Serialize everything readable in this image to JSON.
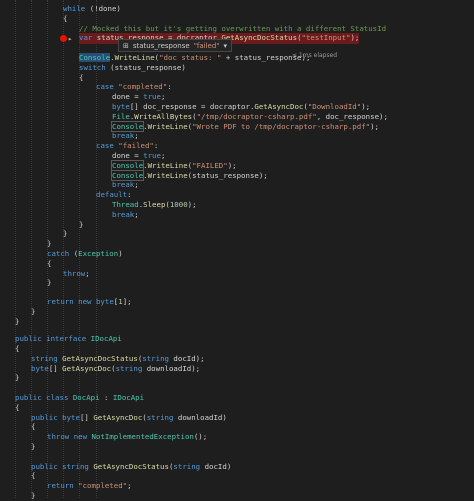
{
  "editor": {
    "lines": [
      {
        "i": 0,
        "segs": [
          [
            "kw",
            "while"
          ],
          [
            "t",
            " (!done)"
          ]
        ]
      },
      {
        "i": 1,
        "segs": [
          [
            "t",
            "{"
          ]
        ]
      },
      {
        "i": 2,
        "segs": [
          [
            "cm",
            "// Mocked this but it's getting overwritten with a different StatusId"
          ]
        ]
      },
      {
        "i": 3,
        "segs": [
          [
            "kw",
            "var"
          ],
          [
            "t",
            " status_response = docraptor."
          ],
          [
            "fn",
            "GetAsyncDocStatus"
          ],
          [
            "t",
            "("
          ],
          [
            "st",
            "\"testInput\""
          ],
          [
            "t",
            ");"
          ]
        ]
      },
      {
        "i": 4,
        "segs": []
      },
      {
        "i": 5,
        "segs": [
          [
            "ty",
            "Console"
          ],
          [
            "t",
            "."
          ],
          [
            "fn",
            "WriteLine"
          ],
          [
            "t",
            "("
          ],
          [
            "st",
            "\"doc status: \""
          ],
          [
            "t",
            " + status_response);"
          ]
        ]
      },
      {
        "i": 6,
        "segs": [
          [
            "kw",
            "switch"
          ],
          [
            "t",
            " (status_response)"
          ]
        ]
      },
      {
        "i": 7,
        "segs": [
          [
            "t",
            "{"
          ]
        ]
      },
      {
        "i": 8,
        "segs": [
          [
            "kw",
            "case"
          ],
          [
            "t",
            " "
          ],
          [
            "st",
            "\"completed\""
          ],
          [
            "t",
            ":"
          ]
        ]
      },
      {
        "i": 9,
        "segs": [
          [
            "t",
            "done = "
          ],
          [
            "kw",
            "true"
          ],
          [
            "t",
            ";"
          ]
        ]
      },
      {
        "i": 10,
        "segs": [
          [
            "kw",
            "byte"
          ],
          [
            "t",
            "[] doc_response = docraptor."
          ],
          [
            "fn",
            "GetAsyncDoc"
          ],
          [
            "t",
            "("
          ],
          [
            "st",
            "\"DownloadId\""
          ],
          [
            "t",
            ");"
          ]
        ]
      },
      {
        "i": 11,
        "segs": [
          [
            "ty",
            "File"
          ],
          [
            "t",
            "."
          ],
          [
            "fn",
            "WriteAllBytes"
          ],
          [
            "t",
            "("
          ],
          [
            "st",
            "\"/tmp/docraptor-csharp.pdf\""
          ],
          [
            "t",
            ", doc_response);"
          ]
        ]
      },
      {
        "i": 12,
        "segs": [
          [
            "ty",
            "Console"
          ],
          [
            "t",
            "."
          ],
          [
            "fn",
            "WriteLine"
          ],
          [
            "t",
            "("
          ],
          [
            "st",
            "\"Wrote PDF to /tmp/docraptor-csharp.pdf\""
          ],
          [
            "t",
            ");"
          ]
        ]
      },
      {
        "i": 13,
        "segs": [
          [
            "kw",
            "break"
          ],
          [
            "t",
            ";"
          ]
        ]
      },
      {
        "i": 14,
        "segs": [
          [
            "kw",
            "case"
          ],
          [
            "t",
            " "
          ],
          [
            "st",
            "\"failed\""
          ],
          [
            "t",
            ":"
          ]
        ]
      },
      {
        "i": 15,
        "segs": [
          [
            "t",
            "done = "
          ],
          [
            "kw",
            "true"
          ],
          [
            "t",
            ";"
          ]
        ]
      },
      {
        "i": 16,
        "segs": [
          [
            "ty",
            "Console"
          ],
          [
            "t",
            "."
          ],
          [
            "fn",
            "WriteLine"
          ],
          [
            "t",
            "("
          ],
          [
            "st",
            "\"FAILED\""
          ],
          [
            "t",
            ");"
          ]
        ]
      },
      {
        "i": 17,
        "segs": [
          [
            "ty",
            "Console"
          ],
          [
            "t",
            "."
          ],
          [
            "fn",
            "WriteLine"
          ],
          [
            "t",
            "(status_response);"
          ]
        ]
      },
      {
        "i": 18,
        "segs": [
          [
            "kw",
            "break"
          ],
          [
            "t",
            ";"
          ]
        ]
      },
      {
        "i": 19,
        "segs": [
          [
            "kw",
            "default"
          ],
          [
            "t",
            ":"
          ]
        ]
      },
      {
        "i": 20,
        "segs": [
          [
            "ty",
            "Thread"
          ],
          [
            "t",
            "."
          ],
          [
            "fn",
            "Sleep"
          ],
          [
            "t",
            "("
          ],
          [
            "nu",
            "1000"
          ],
          [
            "t",
            ");"
          ]
        ]
      },
      {
        "i": 21,
        "segs": [
          [
            "kw",
            "break"
          ],
          [
            "t",
            ";"
          ]
        ]
      },
      {
        "i": 22,
        "segs": [
          [
            "t",
            "}"
          ]
        ]
      },
      {
        "i": 23,
        "segs": [
          [
            "t",
            "}"
          ]
        ]
      },
      {
        "i": 24,
        "segs": [
          [
            "t",
            "}"
          ]
        ]
      },
      {
        "i": 25,
        "segs": [
          [
            "kw",
            "catch"
          ],
          [
            "t",
            " ("
          ],
          [
            "ty",
            "Exception"
          ],
          [
            "t",
            ")"
          ]
        ]
      },
      {
        "i": 26,
        "segs": [
          [
            "t",
            "{"
          ]
        ]
      },
      {
        "i": 27,
        "segs": [
          [
            "kw",
            "throw"
          ],
          [
            "t",
            ";"
          ]
        ]
      },
      {
        "i": 28,
        "segs": [
          [
            "t",
            "}"
          ]
        ]
      },
      {
        "i": 29,
        "segs": []
      },
      {
        "i": 30,
        "segs": [
          [
            "kw",
            "return"
          ],
          [
            "t",
            " "
          ],
          [
            "kw",
            "new"
          ],
          [
            "t",
            " "
          ],
          [
            "kw",
            "byte"
          ],
          [
            "t",
            "["
          ],
          [
            "nu",
            "1"
          ],
          [
            "t",
            "];"
          ]
        ]
      },
      {
        "i": 31,
        "segs": [
          [
            "t",
            "}"
          ]
        ]
      },
      {
        "i": 32,
        "segs": [
          [
            "t",
            "}"
          ]
        ]
      },
      {
        "i": 33,
        "segs": []
      },
      {
        "i": 34,
        "segs": [
          [
            "kw",
            "public"
          ],
          [
            "t",
            " "
          ],
          [
            "kw",
            "interface"
          ],
          [
            "t",
            " "
          ],
          [
            "ty",
            "IDocApi"
          ]
        ]
      },
      {
        "i": 35,
        "segs": [
          [
            "t",
            "{"
          ]
        ]
      },
      {
        "i": 36,
        "segs": [
          [
            "kw",
            "string"
          ],
          [
            "t",
            " "
          ],
          [
            "fn",
            "GetAsyncDocStatus"
          ],
          [
            "t",
            "("
          ],
          [
            "kw",
            "string"
          ],
          [
            "t",
            " docId);"
          ]
        ]
      },
      {
        "i": 37,
        "segs": [
          [
            "kw",
            "byte"
          ],
          [
            "t",
            "[] "
          ],
          [
            "fn",
            "GetAsyncDoc"
          ],
          [
            "t",
            "("
          ],
          [
            "kw",
            "string"
          ],
          [
            "t",
            " downloadId);"
          ]
        ]
      },
      {
        "i": 38,
        "segs": [
          [
            "t",
            "}"
          ]
        ]
      },
      {
        "i": 39,
        "segs": []
      },
      {
        "i": 40,
        "segs": [
          [
            "kw",
            "public"
          ],
          [
            "t",
            " "
          ],
          [
            "kw",
            "class"
          ],
          [
            "t",
            " "
          ],
          [
            "ty",
            "DocApi"
          ],
          [
            "t",
            " : "
          ],
          [
            "ty",
            "IDocApi"
          ]
        ]
      },
      {
        "i": 41,
        "segs": [
          [
            "t",
            "{"
          ]
        ]
      },
      {
        "i": 42,
        "segs": [
          [
            "kw",
            "public"
          ],
          [
            "t",
            " "
          ],
          [
            "kw",
            "byte"
          ],
          [
            "t",
            "[] "
          ],
          [
            "fn",
            "GetAsyncDoc"
          ],
          [
            "t",
            "("
          ],
          [
            "kw",
            "string"
          ],
          [
            "t",
            " downloadId)"
          ]
        ]
      },
      {
        "i": 43,
        "segs": [
          [
            "t",
            "{"
          ]
        ]
      },
      {
        "i": 44,
        "segs": [
          [
            "kw",
            "throw"
          ],
          [
            "t",
            " "
          ],
          [
            "kw",
            "new"
          ],
          [
            "t",
            " "
          ],
          [
            "ty",
            "NotImplementedException"
          ],
          [
            "t",
            "();"
          ]
        ]
      },
      {
        "i": 45,
        "segs": [
          [
            "t",
            "}"
          ]
        ]
      },
      {
        "i": 46,
        "segs": []
      },
      {
        "i": 47,
        "segs": [
          [
            "kw",
            "public"
          ],
          [
            "t",
            " "
          ],
          [
            "kw",
            "string"
          ],
          [
            "t",
            " "
          ],
          [
            "fn",
            "GetAsyncDocStatus"
          ],
          [
            "t",
            "("
          ],
          [
            "kw",
            "string"
          ],
          [
            "t",
            " docId)"
          ]
        ]
      },
      {
        "i": 48,
        "segs": [
          [
            "t",
            "{"
          ]
        ]
      },
      {
        "i": 49,
        "segs": [
          [
            "kw",
            "return"
          ],
          [
            "t",
            " "
          ],
          [
            "st",
            "\"completed\""
          ],
          [
            "t",
            ";"
          ]
        ]
      },
      {
        "i": 50,
        "segs": [
          [
            "t",
            "}"
          ]
        ]
      }
    ]
  },
  "datatip": {
    "variable": "status_response",
    "value": "\"failed\"",
    "pin_icon": "pin-icon"
  },
  "elapsed": "≤ 1ms elapsed",
  "colors": {
    "background": "#1e1e1e",
    "keyword": "#569cd6",
    "type": "#4ec9b0",
    "method": "#dcdcaa",
    "string": "#ce9178",
    "comment": "#6a9955",
    "breakpoint": "#e51400"
  }
}
